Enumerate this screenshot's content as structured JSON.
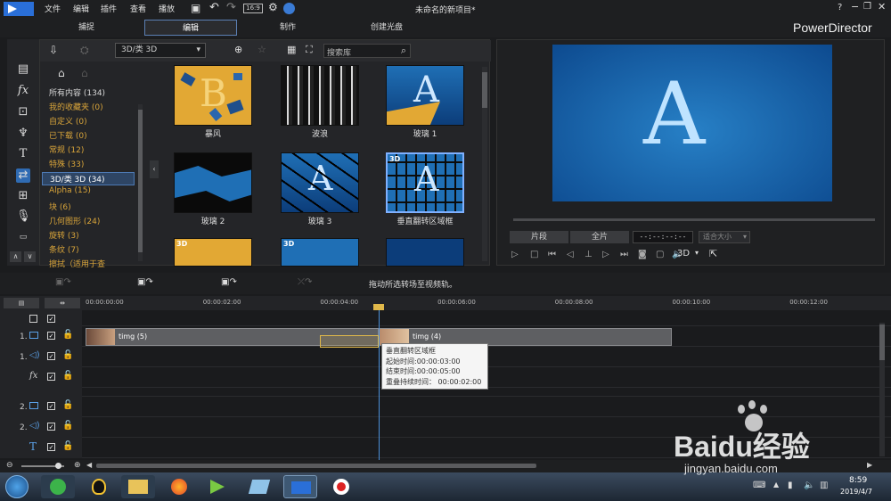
{
  "menu": {
    "file": "文件",
    "edit": "编辑",
    "plugin": "插件",
    "view": "查看",
    "play": "播放"
  },
  "window": {
    "title": "未命名的新项目*",
    "help": "?",
    "brand": "PowerDirector"
  },
  "tabs": {
    "capture": "捕捉",
    "edit": "编辑",
    "produce": "制作",
    "disc": "创建光盘"
  },
  "library": {
    "category_select": "3D/类 3D",
    "search_placeholder": "搜索库",
    "categories": [
      {
        "label": "所有内容 (134)",
        "color": "#d8d8d8"
      },
      {
        "label": "我的收藏夹 (0)",
        "color": "#d9a53a"
      },
      {
        "label": "自定义 (0)",
        "color": "#d9a53a"
      },
      {
        "label": "已下载 (0)",
        "color": "#d9a53a"
      },
      {
        "label": "常规 (12)",
        "color": "#d9a53a"
      },
      {
        "label": "特殊 (33)",
        "color": "#d9a53a"
      },
      {
        "label": "3D/类 3D (34)",
        "color": "#ffffff"
      },
      {
        "label": "Alpha (15)",
        "color": "#d9a53a"
      },
      {
        "label": "块 (6)",
        "color": "#d9a53a"
      },
      {
        "label": "几何图形 (24)",
        "color": "#d9a53a"
      },
      {
        "label": "旋转 (3)",
        "color": "#d9a53a"
      },
      {
        "label": "条纹 (7)",
        "color": "#d9a53a"
      },
      {
        "label": "擦拭（适用于查",
        "color": "#d9a53a"
      }
    ],
    "thumbs": [
      {
        "label": "暴风"
      },
      {
        "label": "波浪"
      },
      {
        "label": "玻璃 1"
      },
      {
        "label": "玻璃 2"
      },
      {
        "label": "玻璃 3"
      },
      {
        "label": "垂直翻转区域框"
      }
    ],
    "thumb_letter_a": "A",
    "thumb_letter_b": "B",
    "badge_3d": "3D"
  },
  "preview": {
    "letter": "A",
    "clip_btn": "片段",
    "full_btn": "全片",
    "timecode": "--:--:--:--",
    "fit": "适合大小",
    "mode_3d": "3D"
  },
  "timeline": {
    "hint": "拖动所选转场至视频轨。",
    "ruler": [
      "00:00:00:00",
      "00:00:02:00",
      "00:00:04:00",
      "00:00:06:00",
      "00:00:08:00",
      "00:00:10:00",
      "00:00:12:00"
    ],
    "clip1": "timg (5)",
    "clip2": "timg (4)",
    "track_labels": [
      "1.",
      "1.",
      "2.",
      "2."
    ],
    "tooltip": {
      "name": "垂直翻转区域框",
      "start": "起始时间:00:00:03:00",
      "end": "结束时间:00:00:05:00",
      "overlap": "重叠持续时间： 00:00:02:00"
    }
  },
  "taskbar": {
    "time": "8:59",
    "date": "2019/4/7"
  },
  "watermark": {
    "brand": "Baidu经验",
    "url": "jingyan.baidu.com"
  }
}
